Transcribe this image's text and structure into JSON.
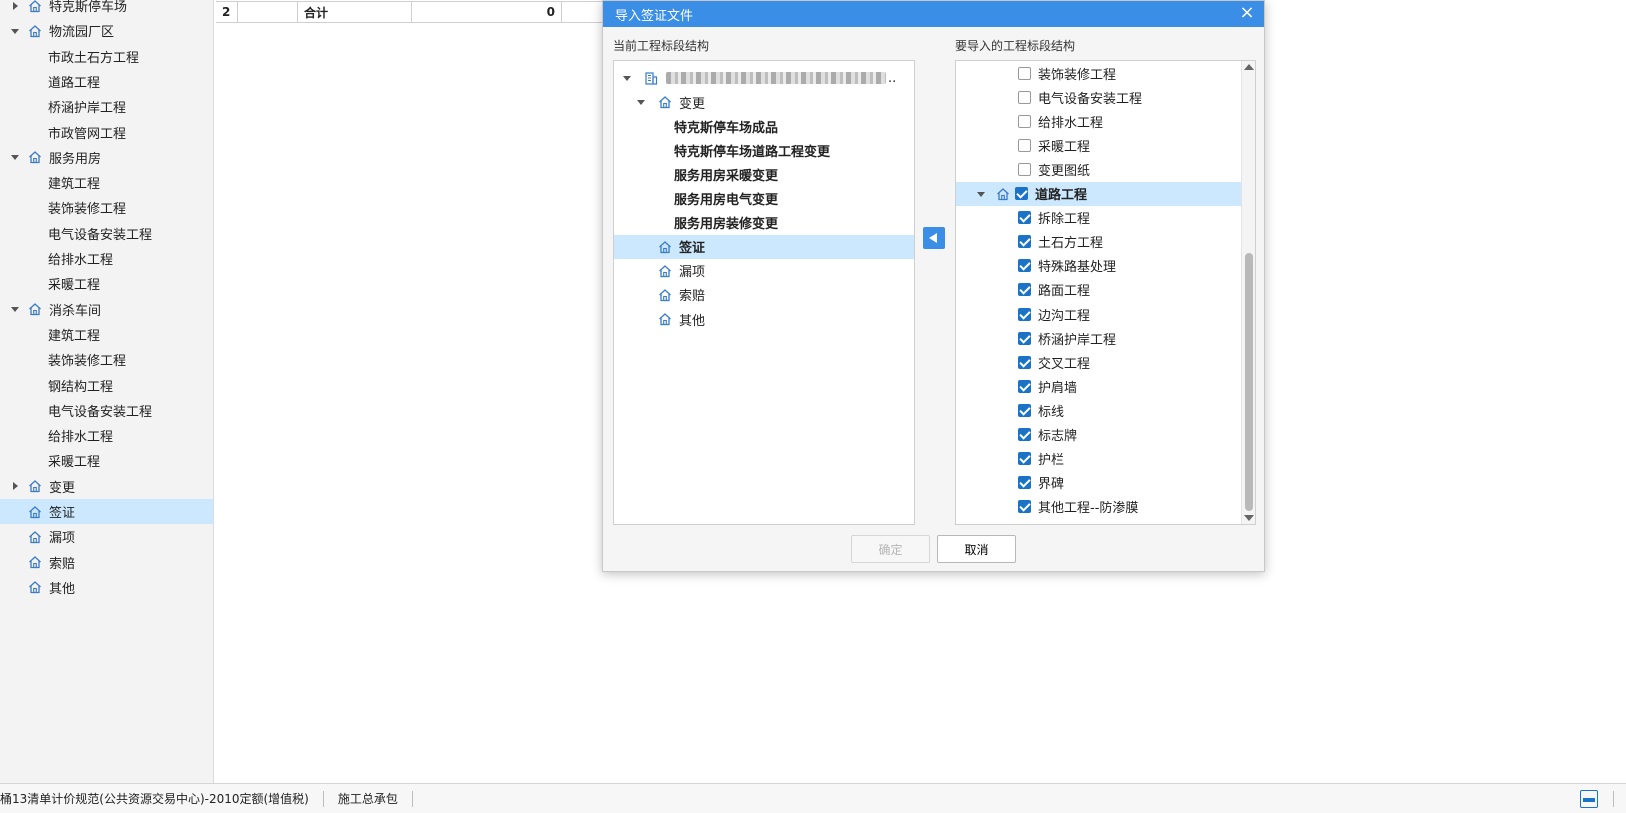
{
  "left_tree": {
    "items": [
      {
        "label": "特克斯停车场",
        "level": 1,
        "expander": "right",
        "icon": "house-icon"
      },
      {
        "label": "物流园厂区",
        "level": 1,
        "expander": "down",
        "icon": "house-icon"
      },
      {
        "label": "市政土石方工程",
        "level": 2
      },
      {
        "label": "道路工程",
        "level": 2
      },
      {
        "label": "桥涵护岸工程",
        "level": 2
      },
      {
        "label": "市政管网工程",
        "level": 2
      },
      {
        "label": "服务用房",
        "level": 1,
        "expander": "down",
        "icon": "house-icon"
      },
      {
        "label": "建筑工程",
        "level": 2
      },
      {
        "label": "装饰装修工程",
        "level": 2
      },
      {
        "label": "电气设备安装工程",
        "level": 2
      },
      {
        "label": "给排水工程",
        "level": 2
      },
      {
        "label": "采暖工程",
        "level": 2
      },
      {
        "label": "消杀车间",
        "level": 1,
        "expander": "down",
        "icon": "house-icon"
      },
      {
        "label": "建筑工程",
        "level": 2
      },
      {
        "label": "装饰装修工程",
        "level": 2
      },
      {
        "label": "钢结构工程",
        "level": 2
      },
      {
        "label": "电气设备安装工程",
        "level": 2
      },
      {
        "label": "给排水工程",
        "level": 2
      },
      {
        "label": "采暖工程",
        "level": 2
      },
      {
        "label": "变更",
        "level": 1,
        "expander": "right",
        "icon": "house-icon"
      },
      {
        "label": "签证",
        "level": 1,
        "icon": "house-icon",
        "selected": true
      },
      {
        "label": "漏项",
        "level": 1,
        "icon": "house-icon"
      },
      {
        "label": "索赔",
        "level": 1,
        "icon": "house-icon"
      },
      {
        "label": "其他",
        "level": 1,
        "icon": "house-icon"
      }
    ]
  },
  "sheet": {
    "row": {
      "index": "2",
      "name": "合计",
      "amount": "0"
    }
  },
  "dialog": {
    "title": "导入签证文件",
    "left_panel_label": "当前工程标段结构",
    "right_panel_label": "要导入的工程标段结构",
    "left_tree": [
      {
        "label": "",
        "blurred": true,
        "level": 0,
        "expander": "down",
        "icon": "building-icon",
        "bold": false
      },
      {
        "label": "变更",
        "level": 1,
        "expander": "down",
        "icon": "house-icon",
        "bold": false
      },
      {
        "label": "特克斯停车场成品",
        "level": 2,
        "bold": true
      },
      {
        "label": "特克斯停车场道路工程变更",
        "level": 2,
        "bold": true
      },
      {
        "label": "服务用房采暖变更",
        "level": 2,
        "bold": true
      },
      {
        "label": "服务用房电气变更",
        "level": 2,
        "bold": true
      },
      {
        "label": "服务用房装修变更",
        "level": 2,
        "bold": true
      },
      {
        "label": "签证",
        "level": 1,
        "icon": "house-icon",
        "bold": true,
        "selected": true
      },
      {
        "label": "漏项",
        "level": 1,
        "icon": "house-icon",
        "bold": false
      },
      {
        "label": "索赔",
        "level": 1,
        "icon": "house-icon",
        "bold": false
      },
      {
        "label": "其他",
        "level": 1,
        "icon": "house-icon",
        "bold": false
      }
    ],
    "right_tree": [
      {
        "label": "装饰装修工程",
        "checked": false
      },
      {
        "label": "电气设备安装工程",
        "checked": false
      },
      {
        "label": "给排水工程",
        "checked": false
      },
      {
        "label": "采暖工程",
        "checked": false
      },
      {
        "label": "变更图纸",
        "checked": false
      },
      {
        "label": "道路工程",
        "checked": true,
        "parent": true,
        "selected": true
      },
      {
        "label": "拆除工程",
        "checked": true
      },
      {
        "label": "土石方工程",
        "checked": true
      },
      {
        "label": "特殊路基处理",
        "checked": true
      },
      {
        "label": "路面工程",
        "checked": true
      },
      {
        "label": "边沟工程",
        "checked": true
      },
      {
        "label": "桥涵护岸工程",
        "checked": true
      },
      {
        "label": "交叉工程",
        "checked": true
      },
      {
        "label": "护肩墙",
        "checked": true
      },
      {
        "label": "标线",
        "checked": true
      },
      {
        "label": "标志牌",
        "checked": true
      },
      {
        "label": "护栏",
        "checked": true
      },
      {
        "label": "界碑",
        "checked": true
      },
      {
        "label": "其他工程--防渗膜",
        "checked": true
      }
    ],
    "ok_label": "确定",
    "cancel_label": "取消"
  },
  "statusbar": {
    "items": [
      "桶13清单计价规范(公共资源交易中心)-2010定额(增值税)",
      "施工总承包"
    ]
  },
  "colors": {
    "accent": "#3a8ee6",
    "selection": "#cce8ff",
    "checkbox": "#1a73c6"
  }
}
